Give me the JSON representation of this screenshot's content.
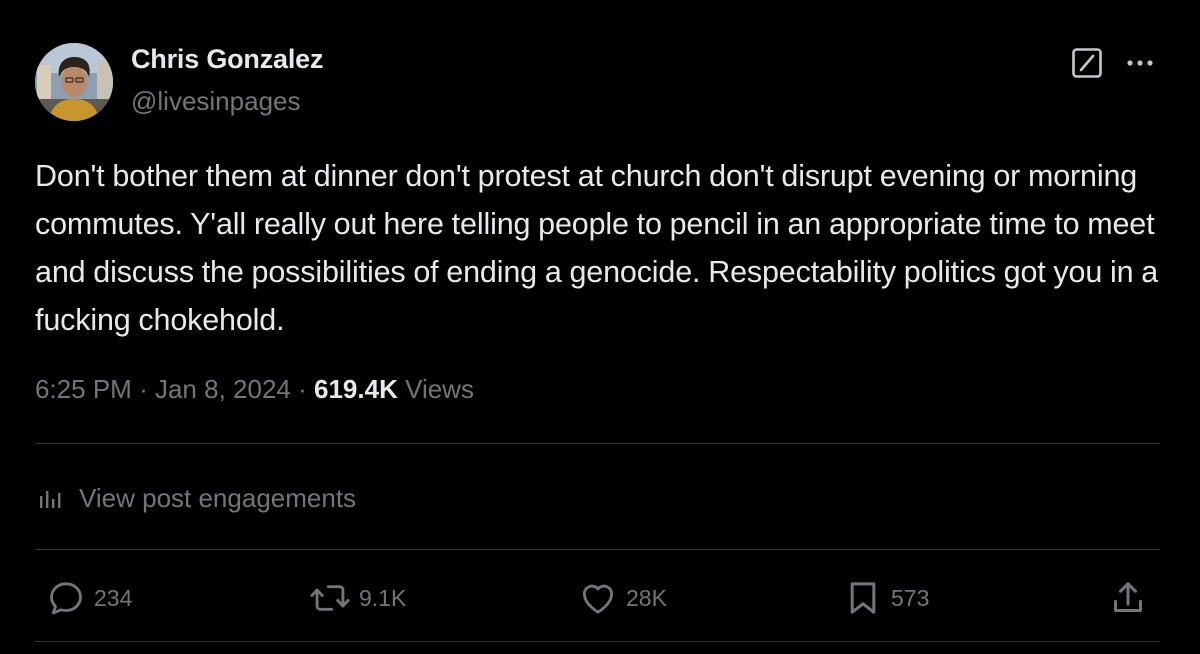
{
  "author": {
    "name": "Chris Gonzalez",
    "handle": "@livesinpages"
  },
  "post": {
    "text": "Don't bother them at dinner don't protest at church don't disrupt evening or morning commutes. Y'all really out here telling people to pencil in an appropriate time to meet and discuss the possibilities of ending a genocide. Respectability politics got you in a fucking chokehold.",
    "time": "6:25 PM",
    "separator": "·",
    "date": "Jan 8, 2024",
    "views_count": "619.4K",
    "views_label": "Views"
  },
  "engagements": {
    "label": "View post engagements",
    "icon": "analytics-icon"
  },
  "actions": {
    "replies": "234",
    "reposts": "9.1K",
    "likes": "28K",
    "bookmarks": "573"
  },
  "icons": {
    "grok": "grok-icon",
    "more": "more-dots-icon",
    "reply": "reply-icon",
    "repost": "repost-icon",
    "like": "heart-icon",
    "bookmark": "bookmark-icon",
    "share": "share-icon"
  },
  "colors": {
    "background": "#000000",
    "primary_text": "#e7e9ea",
    "secondary_text": "#71767b",
    "divider": "#2f3336"
  }
}
